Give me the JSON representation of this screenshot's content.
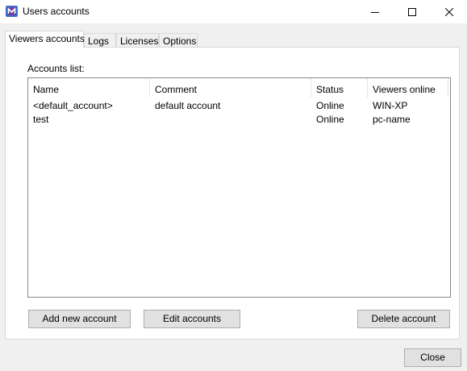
{
  "window": {
    "title": "Users accounts",
    "minimize_icon": "minimize-icon",
    "maximize_icon": "maximize-icon",
    "close_icon": "close-icon"
  },
  "tabs": [
    {
      "label": "Viewers accounts",
      "active": true
    },
    {
      "label": "Logs",
      "active": false
    },
    {
      "label": "Licenses",
      "active": false
    },
    {
      "label": "Options",
      "active": false
    }
  ],
  "accounts": {
    "label": "Accounts list:",
    "columns": [
      "Name",
      "Comment",
      "Status",
      "Viewers online"
    ],
    "rows": [
      {
        "name": "<default_account>",
        "comment": "default account",
        "status": "Online",
        "viewers": "WIN-XP"
      },
      {
        "name": "test",
        "comment": "",
        "status": "Online",
        "viewers": "pc-name"
      }
    ]
  },
  "buttons": {
    "add": "Add new account",
    "edit": "Edit accounts",
    "delete": "Delete account",
    "close": "Close"
  },
  "colors": {
    "app_icon_primary": "#6b3fa0",
    "app_icon_accent": "#3d6fcf"
  }
}
